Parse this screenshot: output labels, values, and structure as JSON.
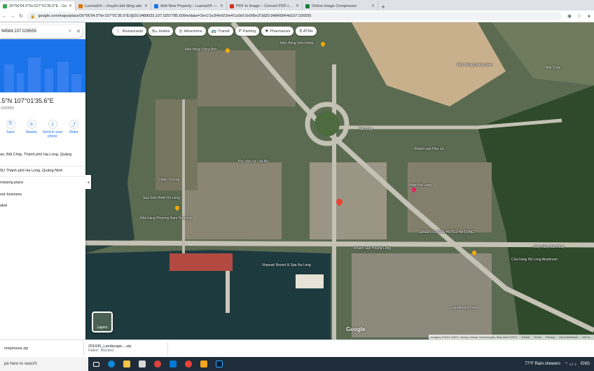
{
  "browser": {
    "tabs": [
      {
        "title": "20°56'54.5\"N+107°01'35.6\"E - Go",
        "color": "#34a853",
        "active": true
      },
      {
        "title": "Luxreal24 – chuyên bất động sản",
        "color": "#e37400",
        "active": false
      },
      {
        "title": "Add New Property ‹ Luxreal24 — ",
        "color": "#1a73e8",
        "active": false
      },
      {
        "title": "PDF to Image – Convert PDF to JP",
        "color": "#d93025",
        "active": false
      },
      {
        "title": "Online Image Compressor",
        "color": "#188038",
        "active": false
      }
    ],
    "new_tab": "+",
    "url": "google.com/maps/place/20°56'54.5\"N+107°01'35.6\"E/@20.9489033,107.0257785,609m/data=!3m1!1e3!4m5!3m4!1s0x0:0x0!8m2!3d20.9484584!4d107.026555"
  },
  "sidebar": {
    "search_value": "94584,107.026555",
    "coord_title": ".5\"N 107°01'35.6\"E",
    "coord_sub": ".026555",
    "actions": [
      {
        "label": "Save",
        "icon": "bookmark-icon"
      },
      {
        "label": "Nearby",
        "icon": "nearby-icon"
      },
      {
        "label": "Send to your phone",
        "icon": "phone-icon"
      },
      {
        "label": "Share",
        "icon": "share-icon"
      }
    ],
    "address_line": "an, Bãi Cháy, Thành phố Hạ Long, Quảng",
    "pluscode_line": "9U Thành phố Hạ Long, Quảng Ninh",
    "missing_place": "missing place",
    "your_business": "our business",
    "label": "abel"
  },
  "map": {
    "chips": [
      {
        "label": "Restaurants",
        "icon": "fork-icon"
      },
      {
        "label": "Hotels",
        "icon": "bed-icon"
      },
      {
        "label": "Attractions",
        "icon": "camera-icon"
      },
      {
        "label": "Transit",
        "icon": "bus-icon"
      },
      {
        "label": "Parking",
        "icon": "parking-icon"
      },
      {
        "label": "Pharmacies",
        "icon": "pill-icon"
      },
      {
        "label": "ATMs",
        "icon": "atm-icon"
      }
    ],
    "layers_label": "Layers",
    "google": "Google",
    "attribution": [
      "Imagery ©2021 CNES / Airbus, Maxar Technologies, Map data ©2021",
      "Global",
      "Terms",
      "Privacy",
      "Send feedback",
      "100 m"
    ],
    "labels": [
      {
        "text": "Nhà Hàng Dũng Anh"
      },
      {
        "text": "Nhà Hàng Viễn Đông"
      },
      {
        "text": "Nhà Hàng Quảng Nam"
      },
      {
        "text": "Bãi Cháy"
      },
      {
        "text": "Bãi Cháy"
      },
      {
        "text": "Khách sạn Hoa Lê"
      },
      {
        "text": "Hotel Hạ Long"
      },
      {
        "text": "Sea Star Hotel Hạ Long"
      },
      {
        "text": "Nhà hàng Phương Nam Hạ Long"
      },
      {
        "text": "Khách Sạn Hoàng Long"
      },
      {
        "text": "GREEN SUITES HOTEL HẠ LONG"
      },
      {
        "text": "Chiêu Dương"
      },
      {
        "text": "Cây Xăng Bãi Cháy"
      },
      {
        "text": "Cửa hàng Hà Long Aluminum"
      },
      {
        "text": "Sunderland Hotel"
      },
      {
        "text": "Vinpearl Resort & Spa Hạ Long"
      },
      {
        "text": "Khu dân cư Lán Bè"
      }
    ]
  },
  "downloads": [
    {
      "name": "ompressor.zip",
      "status": ""
    },
    {
      "name": "201030_Landscape....zip",
      "status": "Failed - Blocked"
    }
  ],
  "taskbar": {
    "search": "pe here to search",
    "weather": "77°F  Rain showers",
    "lang": "ENG"
  }
}
